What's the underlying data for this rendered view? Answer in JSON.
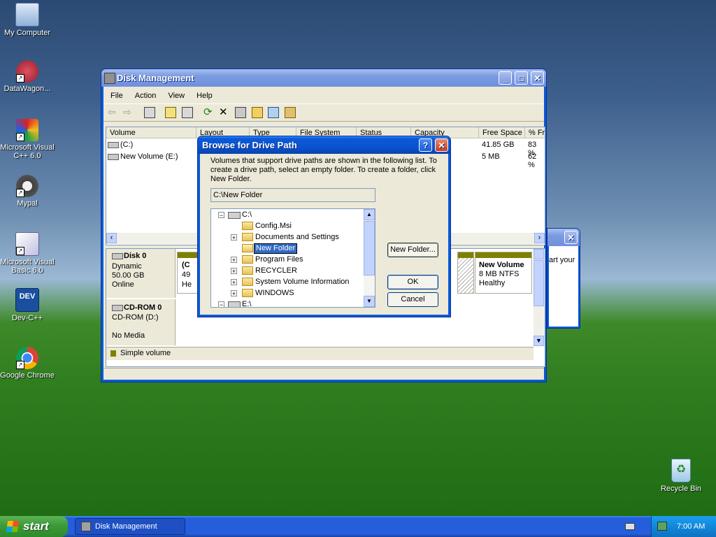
{
  "desktop": {
    "icons": [
      {
        "label": "My Computer"
      },
      {
        "label": "DataWagon..."
      },
      {
        "label": "Microsoft Visual C++ 6.0"
      },
      {
        "label": "Mypal"
      },
      {
        "label": "Microsoft Visual Basic 6.0"
      },
      {
        "label": "Dev-C++"
      },
      {
        "label": "Google Chrome"
      },
      {
        "label": "Recycle Bin"
      }
    ],
    "devcpp_badge": "DEV"
  },
  "disk_mgmt": {
    "title": "Disk Management",
    "menu": [
      "File",
      "Action",
      "View",
      "Help"
    ],
    "columns": [
      "Volume",
      "Layout",
      "Type",
      "File System",
      "Status",
      "Capacity",
      "Free Space",
      "% Fr"
    ],
    "volumes": [
      {
        "name": "(C:)",
        "free": "41.85 GB",
        "pct": "83 %"
      },
      {
        "name": "New Volume (E:)",
        "free": "5 MB",
        "pct": "62 %"
      }
    ],
    "disk0": {
      "name": "Disk 0",
      "type": "Dynamic",
      "size": "50.00 GB",
      "status": "Online"
    },
    "partition_left": {
      "line1": "(C",
      "line2": "49",
      "line3": "He"
    },
    "new_volume": {
      "name": "New Volume",
      "size": "8 MB NTFS",
      "status": "Healthy"
    },
    "cdrom": {
      "name": "CD-ROM 0",
      "type": "CD-ROM (D:)",
      "media": "No Media"
    },
    "legend": "Simple volume"
  },
  "bg_dialog": {
    "text": "art your"
  },
  "browse": {
    "title": "Browse for Drive Path",
    "instructions": "Volumes that support drive paths are shown in the following list. To create a drive path, select an empty folder. To create a folder, click New Folder.",
    "path": "C:\\New Folder",
    "tree": [
      {
        "label": "C:\\",
        "level": 0,
        "expander": "minus",
        "drive": true
      },
      {
        "label": "Config.Msi",
        "level": 1,
        "expander": "none"
      },
      {
        "label": "Documents and Settings",
        "level": 1,
        "expander": "plus"
      },
      {
        "label": "New Folder",
        "level": 1,
        "expander": "none",
        "editing": true
      },
      {
        "label": "Program Files",
        "level": 1,
        "expander": "plus"
      },
      {
        "label": "RECYCLER",
        "level": 1,
        "expander": "plus"
      },
      {
        "label": "System Volume Information",
        "level": 1,
        "expander": "plus"
      },
      {
        "label": "WINDOWS",
        "level": 1,
        "expander": "plus"
      },
      {
        "label": "E:\\",
        "level": 0,
        "expander": "minus",
        "drive": true
      }
    ],
    "new_folder_btn": "New Folder...",
    "ok_btn": "OK",
    "cancel_btn": "Cancel",
    "help_glyph": "?",
    "close_glyph": "✕"
  },
  "taskbar": {
    "start": "start",
    "task": "Disk Management",
    "clock": "7:00 AM"
  }
}
